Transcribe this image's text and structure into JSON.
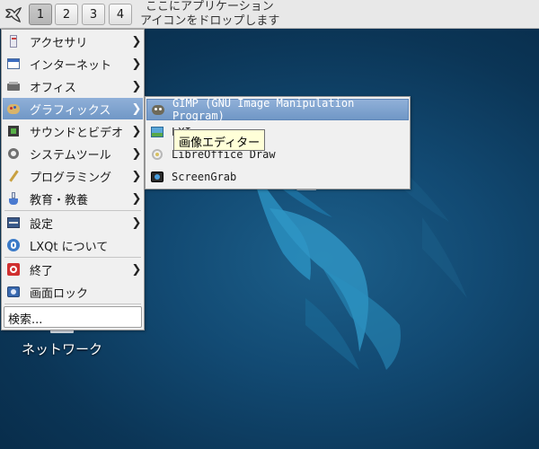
{
  "panel": {
    "desktops": [
      "1",
      "2",
      "3",
      "4"
    ],
    "active_desktop": "1",
    "quicklaunch_hint_line1": "ここにアプリケーション",
    "quicklaunch_hint_line2": "アイコンをドロップします"
  },
  "main_menu": {
    "items": [
      {
        "label": "アクセサリ",
        "icon": "accessories-icon",
        "submenu": true
      },
      {
        "label": "インターネット",
        "icon": "internet-icon",
        "submenu": true
      },
      {
        "label": "オフィス",
        "icon": "office-icon",
        "submenu": true
      },
      {
        "label": "グラフィックス",
        "icon": "graphics-icon",
        "submenu": true
      },
      {
        "label": "サウンドとビデオ",
        "icon": "multimedia-icon",
        "submenu": true
      },
      {
        "label": "システムツール",
        "icon": "system-tools-icon",
        "submenu": true
      },
      {
        "label": "プログラミング",
        "icon": "development-icon",
        "submenu": true
      },
      {
        "label": "教育・教養",
        "icon": "education-icon",
        "submenu": true
      },
      {
        "label": "設定",
        "icon": "settings-icon",
        "submenu": true
      },
      {
        "label": "LXQt について",
        "icon": "lxqt-about-icon",
        "submenu": false
      },
      {
        "label": "終了",
        "icon": "shutdown-icon",
        "submenu": true
      },
      {
        "label": "画面ロック",
        "icon": "lock-screen-icon",
        "submenu": false
      }
    ],
    "highlighted": "グラフィックス",
    "search_label": "検索..."
  },
  "graphics_submenu": {
    "items": [
      {
        "label": "GIMP (GNU Image Manipulation Program)",
        "icon": "gimp-icon"
      },
      {
        "label": "LXImage",
        "icon": "image-viewer-icon"
      },
      {
        "label": "LibreOffice Draw",
        "icon": "libreoffice-draw-icon"
      },
      {
        "label": "ScreenGrab",
        "icon": "screengrab-icon"
      }
    ],
    "highlighted": "GIMP (GNU Image Manipulation Program)"
  },
  "tooltip": {
    "text": "画像エディター"
  },
  "desktop": {
    "icons": [
      {
        "label": "ネットワーク",
        "icon": "network-icon"
      }
    ]
  },
  "colors": {
    "highlight": "#7a9fcc",
    "desktop_bg": "#0b3a5e",
    "menu_bg": "#f0f0f0"
  }
}
